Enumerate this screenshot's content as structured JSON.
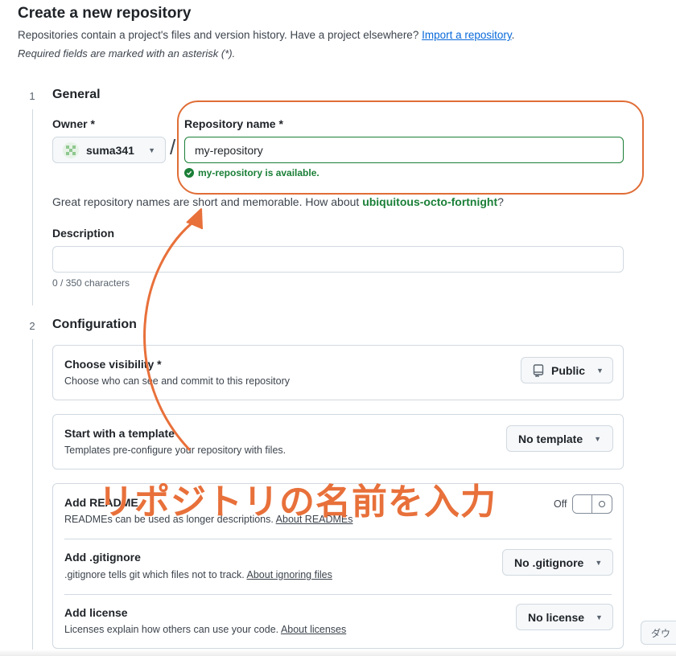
{
  "header": {
    "title": "Create a new repository",
    "subtitle_prefix": "Repositories contain a project's files and version history. Have a project elsewhere?",
    "import_link": "Import a repository",
    "subtitle_suffix": ".",
    "required_note": "Required fields are marked with an asterisk (*)."
  },
  "general": {
    "step_number": "1",
    "title": "General",
    "owner_label": "Owner *",
    "owner_value": "suma341",
    "repo_label": "Repository name *",
    "repo_value": "my-repository",
    "available_text": "my-repository is available.",
    "hint_prefix": "Great repository names are short and memorable. How about",
    "hint_suggestion": "ubiquitous-octo-fortnight",
    "hint_suffix": "?",
    "description_label": "Description",
    "description_value": "",
    "char_count": "0 / 350 characters"
  },
  "configuration": {
    "step_number": "2",
    "title": "Configuration",
    "visibility": {
      "title": "Choose visibility *",
      "desc": "Choose who can see and commit to this repository",
      "value": "Public",
      "icon": "repo-icon"
    },
    "template": {
      "title": "Start with a template",
      "desc": "Templates pre-configure your repository with files.",
      "value": "No template"
    },
    "readme": {
      "title": "Add README",
      "desc": "READMEs can be used as longer descriptions.",
      "link": "About READMEs",
      "toggle_label": "Off",
      "enabled": false
    },
    "gitignore": {
      "title": "Add .gitignore",
      "desc": ".gitignore tells git which files not to track.",
      "link": "About ignoring files",
      "value": "No .gitignore"
    },
    "license": {
      "title": "Add license",
      "desc": "Licenses explain how others can use your code.",
      "link": "About licenses",
      "value": "No license"
    }
  },
  "annotation": {
    "text": "リポジトリの名前を入力",
    "color": "#e8703a"
  },
  "side_button": {
    "label": "ダウ"
  },
  "colors": {
    "link": "#0969da",
    "success": "#1a7f37",
    "border": "#d1d9e0"
  }
}
